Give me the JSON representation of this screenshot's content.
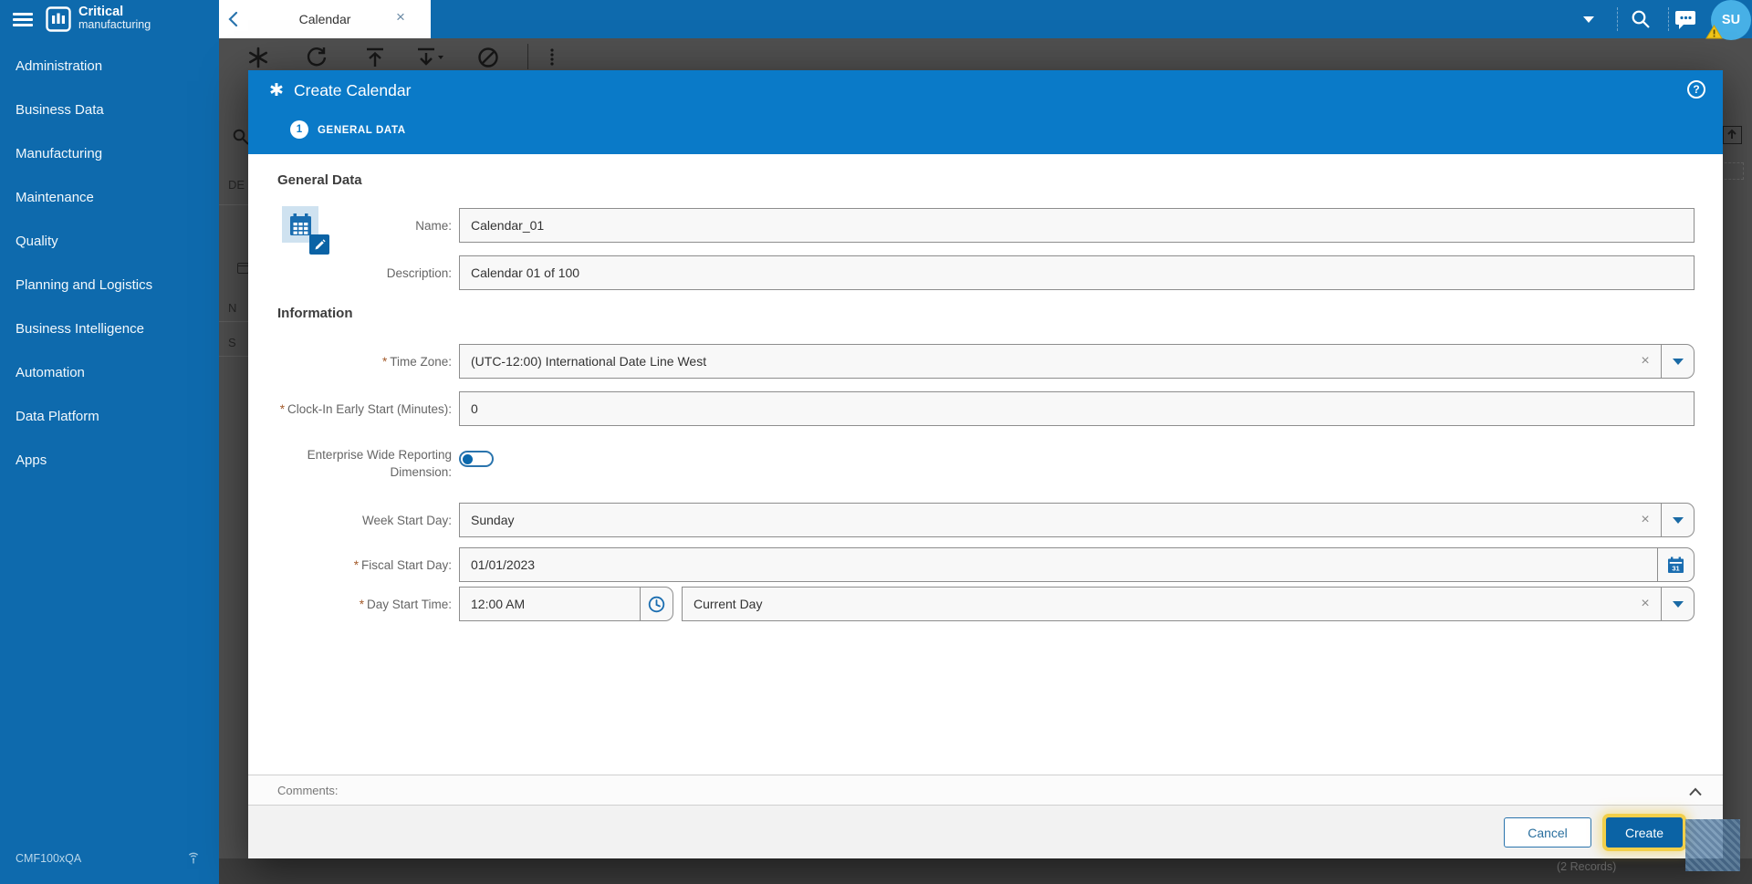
{
  "brand": {
    "line1": "Critical",
    "line2": "manufacturing"
  },
  "header": {
    "tab_label": "Calendar",
    "user_initials": "SU"
  },
  "icons": {
    "star": "✱",
    "close": "×",
    "clear": "×",
    "help": "?",
    "calendar_day": "31"
  },
  "sidebar": {
    "items": [
      "Administration",
      "Business Data",
      "Manufacturing",
      "Maintenance",
      "Quality",
      "Planning and Logistics",
      "Business Intelligence",
      "Automation",
      "Data Platform",
      "Apps"
    ],
    "environment": "CMF100xQA"
  },
  "background": {
    "fragments": {
      "f1": "DE",
      "f2": "N",
      "f3": "S"
    },
    "records": "(2 Records)"
  },
  "modal": {
    "title": "Create Calendar",
    "step_number": "1",
    "step_label": "GENERAL DATA",
    "section_general": "General Data",
    "section_information": "Information",
    "required_marker": "*",
    "fields": {
      "name": {
        "label": "Name:",
        "value": "Calendar_01"
      },
      "description": {
        "label": "Description:",
        "value": "Calendar 01 of 100"
      },
      "time_zone": {
        "label": "Time Zone:",
        "value": "(UTC-12:00) International Date Line West"
      },
      "clock_in": {
        "label": "Clock-In Early Start (Minutes):",
        "value": "0"
      },
      "enterprise_dim": {
        "label": "Enterprise Wide Reporting Dimension:",
        "state": "off"
      },
      "week_start": {
        "label": "Week Start Day:",
        "value": "Sunday"
      },
      "fiscal_start": {
        "label": "Fiscal Start Day:",
        "value": "01/01/2023"
      },
      "day_start_time": {
        "label": "Day Start Time:",
        "time_value": "12:00 AM",
        "day_value": "Current Day"
      }
    },
    "comments_label": "Comments:",
    "cancel_label": "Cancel",
    "create_label": "Create"
  },
  "colors": {
    "sidebar_blue": "#0e6aad",
    "modal_header_blue": "#0a7ac8",
    "primary_button": "#0b63a5",
    "focus_ring": "#f2cf4a",
    "required_marker": "#a35a2a",
    "avatar": "#47b0e6",
    "warning_badge": "#f2c518",
    "field_background": "#f8f8f8"
  }
}
